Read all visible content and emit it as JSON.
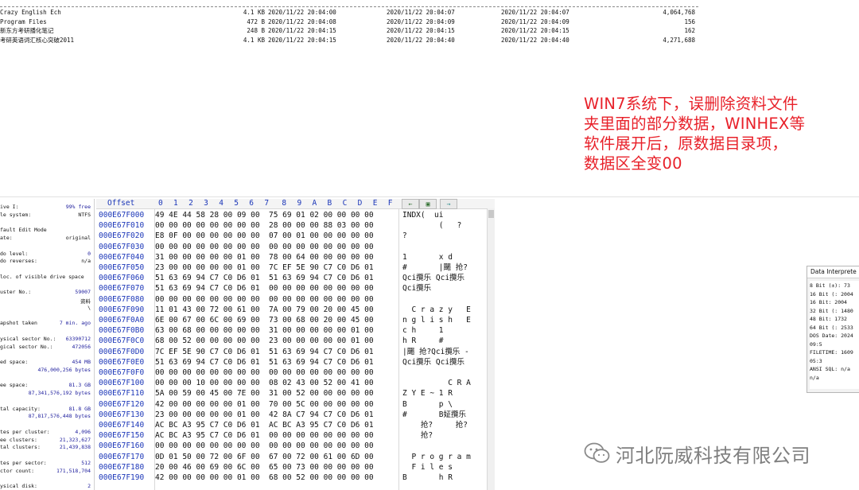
{
  "file_list": {
    "rows": [
      {
        "name": "Crazy English Ech",
        "size": "4.1 KB",
        "created": "2020/11/22  20:04:00",
        "modified": "2020/11/22  20:04:07",
        "accessed": "2020/11/22  20:04:07",
        "value": "4,064,768"
      },
      {
        "name": "Program Files",
        "size": "472 B",
        "created": "2020/11/22  20:04:08",
        "modified": "2020/11/22  20:04:09",
        "accessed": "2020/11/22  20:04:09",
        "value": "156"
      },
      {
        "name": "新东方考研播化笔记",
        "size": "248 B",
        "created": "2020/11/22  20:04:15",
        "modified": "2020/11/22  20:04:15",
        "accessed": "2020/11/22  20:04:15",
        "value": "162"
      },
      {
        "name": "考研英语词汇核心突破2011",
        "size": "4.1 KB",
        "created": "2020/11/22  20:04:15",
        "modified": "2020/11/22  20:04:40",
        "accessed": "2020/11/22  20:04:40",
        "value": "4,271,688"
      }
    ]
  },
  "annotation": {
    "lines": [
      "WIN7系统下，误删除资料文件",
      "夹里面的部分数据，WINHEX等",
      "软件展开后，原数据目录项，",
      "数据区全变00"
    ],
    "color": "#e8212a"
  },
  "info_panel": {
    "rows": [
      {
        "k": "ive I:",
        "v": "99% free"
      },
      {
        "k": "le system:",
        "v": "NTFS"
      },
      {
        "k": "",
        "v": ""
      },
      {
        "k": "fault Edit Mode",
        "v": ""
      },
      {
        "k": "ate:",
        "v": "original"
      },
      {
        "k": "",
        "v": ""
      },
      {
        "k": "do level:",
        "v": "0"
      },
      {
        "k": "do reverses:",
        "v": "n/a"
      },
      {
        "k": "",
        "v": ""
      },
      {
        "k": "loc. of visible drive space",
        "v": ""
      },
      {
        "k": "",
        "v": ""
      },
      {
        "k": "uster No.:",
        "v": "59007"
      },
      {
        "k": "",
        "v": "资料"
      },
      {
        "k": "",
        "v": "\\"
      },
      {
        "k": "",
        "v": ""
      },
      {
        "k": "apshot taken",
        "v": "7 min. ago"
      },
      {
        "k": "",
        "v": ""
      },
      {
        "k": "ysical sector No.:",
        "v": "63390712"
      },
      {
        "k": "gical sector No.:",
        "v": "472056"
      },
      {
        "k": "",
        "v": ""
      },
      {
        "k": "ed space:",
        "v": "454 MB"
      },
      {
        "k": "",
        "v": "476,000,256 bytes"
      },
      {
        "k": "",
        "v": ""
      },
      {
        "k": "ee space:",
        "v": "81.3 GB"
      },
      {
        "k": "",
        "v": "87,341,576,192 bytes"
      },
      {
        "k": "",
        "v": ""
      },
      {
        "k": "tal capacity:",
        "v": "81.8 GB"
      },
      {
        "k": "",
        "v": "87,817,576,448 bytes"
      },
      {
        "k": "",
        "v": ""
      },
      {
        "k": "tes per cluster:",
        "v": "4,096"
      },
      {
        "k": "ee clusters:",
        "v": "21,323,627"
      },
      {
        "k": "tal clusters:",
        "v": "21,439,838"
      },
      {
        "k": "",
        "v": ""
      },
      {
        "k": "tes per sector:",
        "v": "512"
      },
      {
        "k": "ctor count:",
        "v": "171,518,704"
      },
      {
        "k": "",
        "v": ""
      },
      {
        "k": "ysical disk:",
        "v": "2"
      }
    ]
  },
  "hex_editor": {
    "offset_label": "Offset",
    "columns": [
      "0",
      "1",
      "2",
      "3",
      "4",
      "5",
      "6",
      "7",
      "8",
      "9",
      "A",
      "B",
      "C",
      "D",
      "E",
      "F"
    ],
    "rows": [
      {
        "off": "000E67F000",
        "bytes": "49 4E 44 58 28 00 09 00  75 69 01 02 00 00 00 00",
        "txt": "INDX(  ui"
      },
      {
        "off": "000E67F010",
        "bytes": "00 00 00 00 00 00 00 00  28 00 00 00 88 03 00 00",
        "txt": "        (   ?"
      },
      {
        "off": "000E67F020",
        "bytes": "E8 0F 00 00 00 00 00 00  07 00 01 00 00 00 00 00",
        "txt": "?"
      },
      {
        "off": "000E67F030",
        "bytes": "00 00 00 00 00 00 00 00  00 00 00 00 00 00 00 00",
        "txt": ""
      },
      {
        "off": "000E67F040",
        "bytes": "31 00 00 00 00 00 01 00  78 00 64 00 00 00 00 00",
        "txt": "1       x d"
      },
      {
        "off": "000E67F050",
        "bytes": "23 00 00 00 00 00 01 00  7C EF 5E 90 C7 C0 D6 01",
        "txt": "#       |颺 抢?"
      },
      {
        "off": "000E67F060",
        "bytes": "51 63 69 94 C7 C0 D6 01  51 63 69 94 C7 C0 D6 01",
        "txt": "Qci攬乐 Qci攬乐"
      },
      {
        "off": "000E67F070",
        "bytes": "51 63 69 94 C7 C0 D6 01  00 00 00 00 00 00 00 00",
        "txt": "Qci攬乐"
      },
      {
        "off": "000E67F080",
        "bytes": "00 00 00 00 00 00 00 00  00 00 00 00 00 00 00 00",
        "txt": ""
      },
      {
        "off": "000E67F090",
        "bytes": "11 01 43 00 72 00 61 00  7A 00 79 00 20 00 45 00",
        "txt": "  C r a z y   E"
      },
      {
        "off": "000E67F0A0",
        "bytes": "6E 00 67 00 6C 00 69 00  73 00 68 00 20 00 45 00",
        "txt": "n g l i s h   E"
      },
      {
        "off": "000E67F0B0",
        "bytes": "63 00 68 00 00 00 00 00  31 00 00 00 00 00 01 00",
        "txt": "c h     1"
      },
      {
        "off": "000E67F0C0",
        "bytes": "68 00 52 00 00 00 00 00  23 00 00 00 00 00 01 00",
        "txt": "h R     #"
      },
      {
        "off": "000E67F0D0",
        "bytes": "7C EF 5E 90 C7 C0 D6 01  51 63 69 94 C7 C0 D6 01",
        "txt": "|颺 抢?Qci攬乐 -"
      },
      {
        "off": "000E67F0E0",
        "bytes": "51 63 69 94 C7 C0 D6 01  51 63 69 94 C7 C0 D6 01",
        "txt": "Qci攬乐 Qci攬乐"
      },
      {
        "off": "000E67F0F0",
        "bytes": "00 00 00 00 00 00 00 00  00 00 00 00 00 00 00 00",
        "txt": ""
      },
      {
        "off": "000E67F100",
        "bytes": "00 00 00 10 00 00 00 00  08 02 43 00 52 00 41 00",
        "txt": "          C R A"
      },
      {
        "off": "000E67F110",
        "bytes": "5A 00 59 00 45 00 7E 00  31 00 52 00 00 00 00 00",
        "txt": "Z Y E ~ 1 R"
      },
      {
        "off": "000E67F120",
        "bytes": "42 00 00 00 00 00 01 00  70 00 5C 00 00 00 00 00",
        "txt": "B       p \\"
      },
      {
        "off": "000E67F130",
        "bytes": "23 00 00 00 00 00 01 00  42 8A C7 94 C7 C0 D6 01",
        "txt": "#       B姃攬乐"
      },
      {
        "off": "000E67F140",
        "bytes": "AC BC A3 95 C7 C0 D6 01  AC BC A3 95 C7 C0 D6 01",
        "txt": "    抢?     抢?"
      },
      {
        "off": "000E67F150",
        "bytes": "AC BC A3 95 C7 C0 D6 01  00 00 00 00 00 00 00 00",
        "txt": "    抢?"
      },
      {
        "off": "000E67F160",
        "bytes": "00 00 00 00 00 00 00 00  00 00 00 00 00 00 00 00",
        "txt": ""
      },
      {
        "off": "000E67F170",
        "bytes": "0D 01 50 00 72 00 6F 00  67 00 72 00 61 00 6D 00",
        "txt": "  P r o g r a m"
      },
      {
        "off": "000E67F180",
        "bytes": "20 00 46 00 69 00 6C 00  65 00 73 00 00 00 00 00",
        "txt": "  F i l e s"
      },
      {
        "off": "000E67F190",
        "bytes": "42 00 00 00 00 00 01 00  68 00 52 00 00 00 00 00",
        "txt": "B       h R"
      }
    ]
  },
  "data_interpreter": {
    "title": "Data Interprete",
    "rows": [
      "8 Bit (±): 73",
      "  16 Bit (: 2004",
      "    16 Bit: 2004",
      "  32 Bit (: 1480",
      "    48 Bit: 1732",
      "  64 Bit (: 2533",
      "DOS Date: 2024",
      "          09:5",
      "FILETIME: 1609",
      "          05:3",
      "ANSI SQL: n/a",
      "          n/a"
    ]
  },
  "watermark": {
    "text": "河北阮威科技有限公司"
  }
}
